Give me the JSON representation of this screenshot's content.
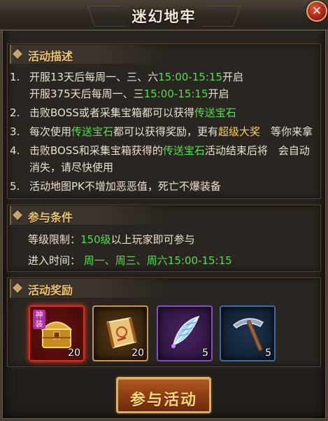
{
  "window": {
    "title": "迷幻地牢"
  },
  "sections": {
    "description": {
      "title": "活动描述",
      "items": [
        {
          "num": "1.",
          "lines": [
            [
              {
                "t": "开服13天后每周一、三、六"
              },
              {
                "t": "15:00-15:15",
                "hl": "green"
              },
              {
                "t": "开启"
              }
            ],
            [
              {
                "t": "开服375天后每周一、三"
              },
              {
                "t": "15:00-15:15",
                "hl": "green"
              },
              {
                "t": "开启"
              }
            ]
          ]
        },
        {
          "num": "2.",
          "lines": [
            [
              {
                "t": "击败BOSS或者采集宝箱都可以获得"
              },
              {
                "t": "传送宝石",
                "hl": "green"
              }
            ]
          ]
        },
        {
          "num": "3.",
          "lines": [
            [
              {
                "t": "每次使用"
              },
              {
                "t": "传送宝石",
                "hl": "green"
              },
              {
                "t": "都可以获得奖励，更有"
              },
              {
                "t": "超级大奖",
                "hl": "gold"
              },
              {
                "t": "　等你来拿"
              }
            ]
          ]
        },
        {
          "num": "4.",
          "lines": [
            [
              {
                "t": "击败BOSS和采集宝箱获得的"
              },
              {
                "t": "传送宝石",
                "hl": "green"
              },
              {
                "t": "活动结束后将　会自动消失，请尽快使用"
              }
            ]
          ]
        },
        {
          "num": "5.",
          "lines": [
            [
              {
                "t": "活动地图PK不增加恶恶值，死亡不爆装备"
              }
            ]
          ]
        }
      ]
    },
    "conditions": {
      "title": "参与条件",
      "level_label": "等级限制：",
      "level_value": "150级",
      "level_suffix": "以上玩家即可参与",
      "time_label": "进入时间：",
      "time_value": "周一、周三、周六15:00-15:15"
    },
    "rewards": {
      "title": "活动奖励",
      "items": [
        {
          "icon": "golden-chest-icon",
          "tag": "神装",
          "count": "20",
          "quality_color": "#e02a1e"
        },
        {
          "icon": "scroll-icon",
          "count": "20",
          "quality_color": "#c89a3a"
        },
        {
          "icon": "feather-icon",
          "count": "5",
          "quality_color": "#8a4ec4"
        },
        {
          "icon": "pickaxe-icon",
          "count": "5",
          "quality_color": "#3b6ea8"
        }
      ]
    }
  },
  "actions": {
    "join_label": "参与活动",
    "close_icon": "close-icon"
  }
}
